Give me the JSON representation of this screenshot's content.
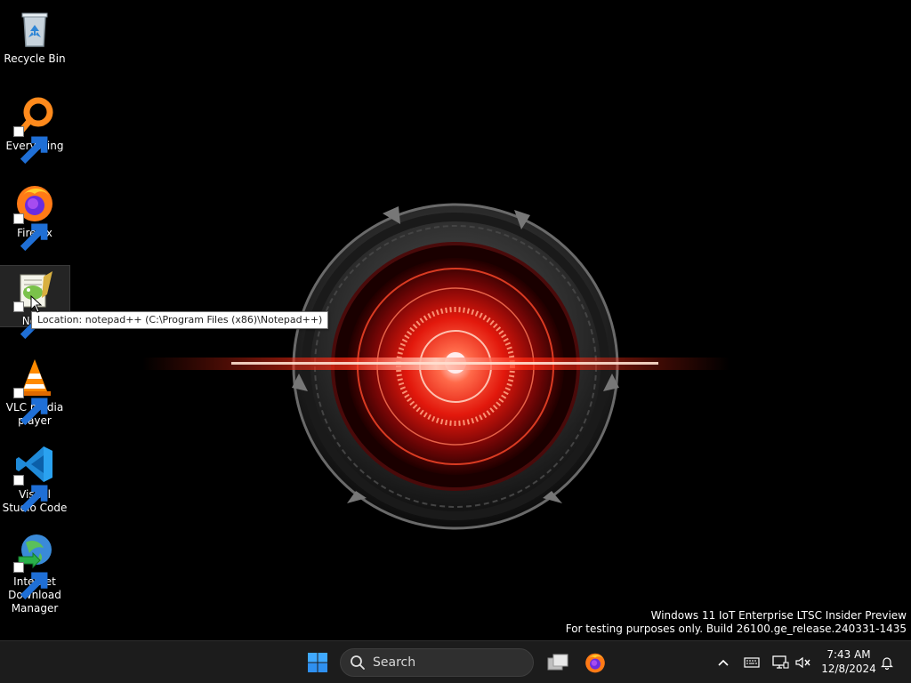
{
  "desktop": {
    "icons": [
      {
        "label": "Recycle Bin",
        "icon": "recycle-bin-icon"
      },
      {
        "label": "Everything",
        "icon": "everything-search-icon"
      },
      {
        "label": "Firefox",
        "icon": "firefox-icon"
      },
      {
        "label": "Notepad++",
        "label_visible": "Note",
        "icon": "notepadpp-icon"
      },
      {
        "label": "VLC media player",
        "icon": "vlc-icon"
      },
      {
        "label": "Visual Studio Code",
        "icon": "vscode-icon"
      },
      {
        "label": "Internet Download Manager",
        "icon": "idm-icon"
      }
    ],
    "tooltip": "Location: notepad++ (C:\\Program Files (x86)\\Notepad++)",
    "watermark": {
      "line1": "Windows 11 IoT Enterprise LTSC Insider Preview",
      "line2": "For testing purposes only. Build 26100.ge_release.240331-1435"
    }
  },
  "taskbar": {
    "search_placeholder": "Search",
    "clock_time": "7:43 AM",
    "clock_date": "12/8/2024"
  },
  "colors": {
    "taskbar_bg": "#1c1c1c",
    "start_blue": "#2f9bff",
    "accent_red": "#ff2a12"
  }
}
